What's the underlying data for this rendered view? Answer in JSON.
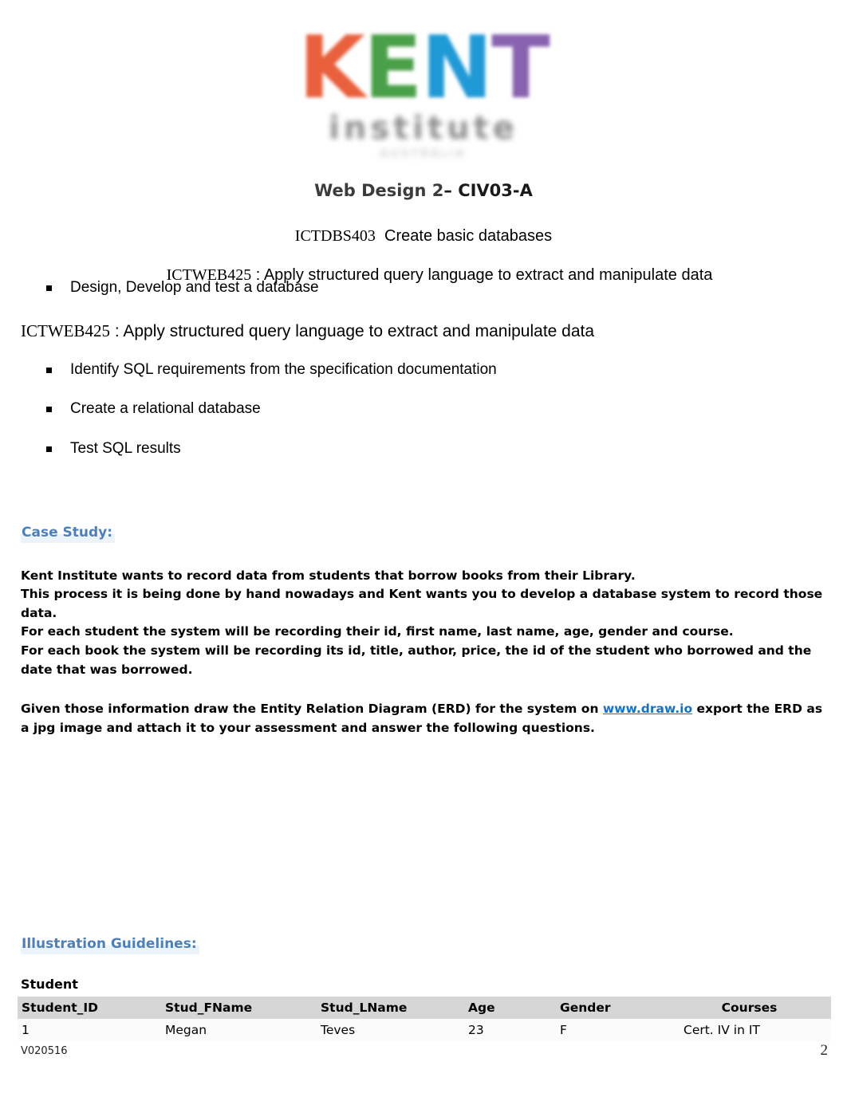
{
  "logo": {
    "letters": [
      {
        "glyph": "K",
        "color": "#e8603c"
      },
      {
        "glyph": "E",
        "color": "#4aa048"
      },
      {
        "glyph": "N",
        "color": "#1f9ad6"
      },
      {
        "glyph": "T",
        "color": "#8a63b0"
      }
    ],
    "wordmark": "KENT",
    "subtext": "institute",
    "tagline": "AUSTRALIA"
  },
  "title": {
    "main": "Web Design 2",
    "separator": "– ",
    "code": "CIV03-A"
  },
  "units": {
    "unit1_code": "ICTDBS403",
    "unit1_name": "Create basic databases",
    "unit2_top_line": "ICTWEB425 : Apply structured query language to extract and manipulate data",
    "unit1_bullets": [
      "Design, Develop and test a database"
    ],
    "unit2_heading_code": "ICTWEB425",
    "unit2_heading_rest": " : Apply structured query language to extract and manipulate data",
    "unit2_bullets": [
      "Identify SQL requirements from the specification documentation",
      "Create a relational database",
      "Test SQL results"
    ]
  },
  "case_study": {
    "heading": "Case Study:",
    "lines": [
      "Kent Institute wants to record data from students that borrow books from their Library.",
      "This process it is being done by hand nowadays and Kent wants you to develop a database system to record those data.",
      "For each student the system will be recording their id, first name, last name, age, gender and course.",
      "For each book the system will be recording its id, title, author, price, the id of the student who borrowed and the date that was borrowed."
    ],
    "instructions_before_link": "Given those information draw the Entity Relation Diagram (ERD) for the system on ",
    "link_label": "www.draw.io",
    "instructions_after_link": " export the ERD as a jpg image and attach it to your assessment and answer the following questions."
  },
  "illustration": {
    "heading": "Illustration Guidelines:",
    "entity_label": "Student",
    "columns": [
      "Student_ID",
      "Stud_FName",
      "Stud_LName",
      "Age",
      "Gender",
      "Courses"
    ],
    "rows": [
      [
        "1",
        "Megan",
        "Teves",
        "23",
        "F",
        "Cert. IV in IT"
      ]
    ]
  },
  "footer": {
    "version": "V020516",
    "page_number": "2"
  },
  "colors": {
    "heading_blue": "#4d80ba",
    "link_blue": "#1671c4",
    "table_header_bg": "#d6d6d6"
  }
}
